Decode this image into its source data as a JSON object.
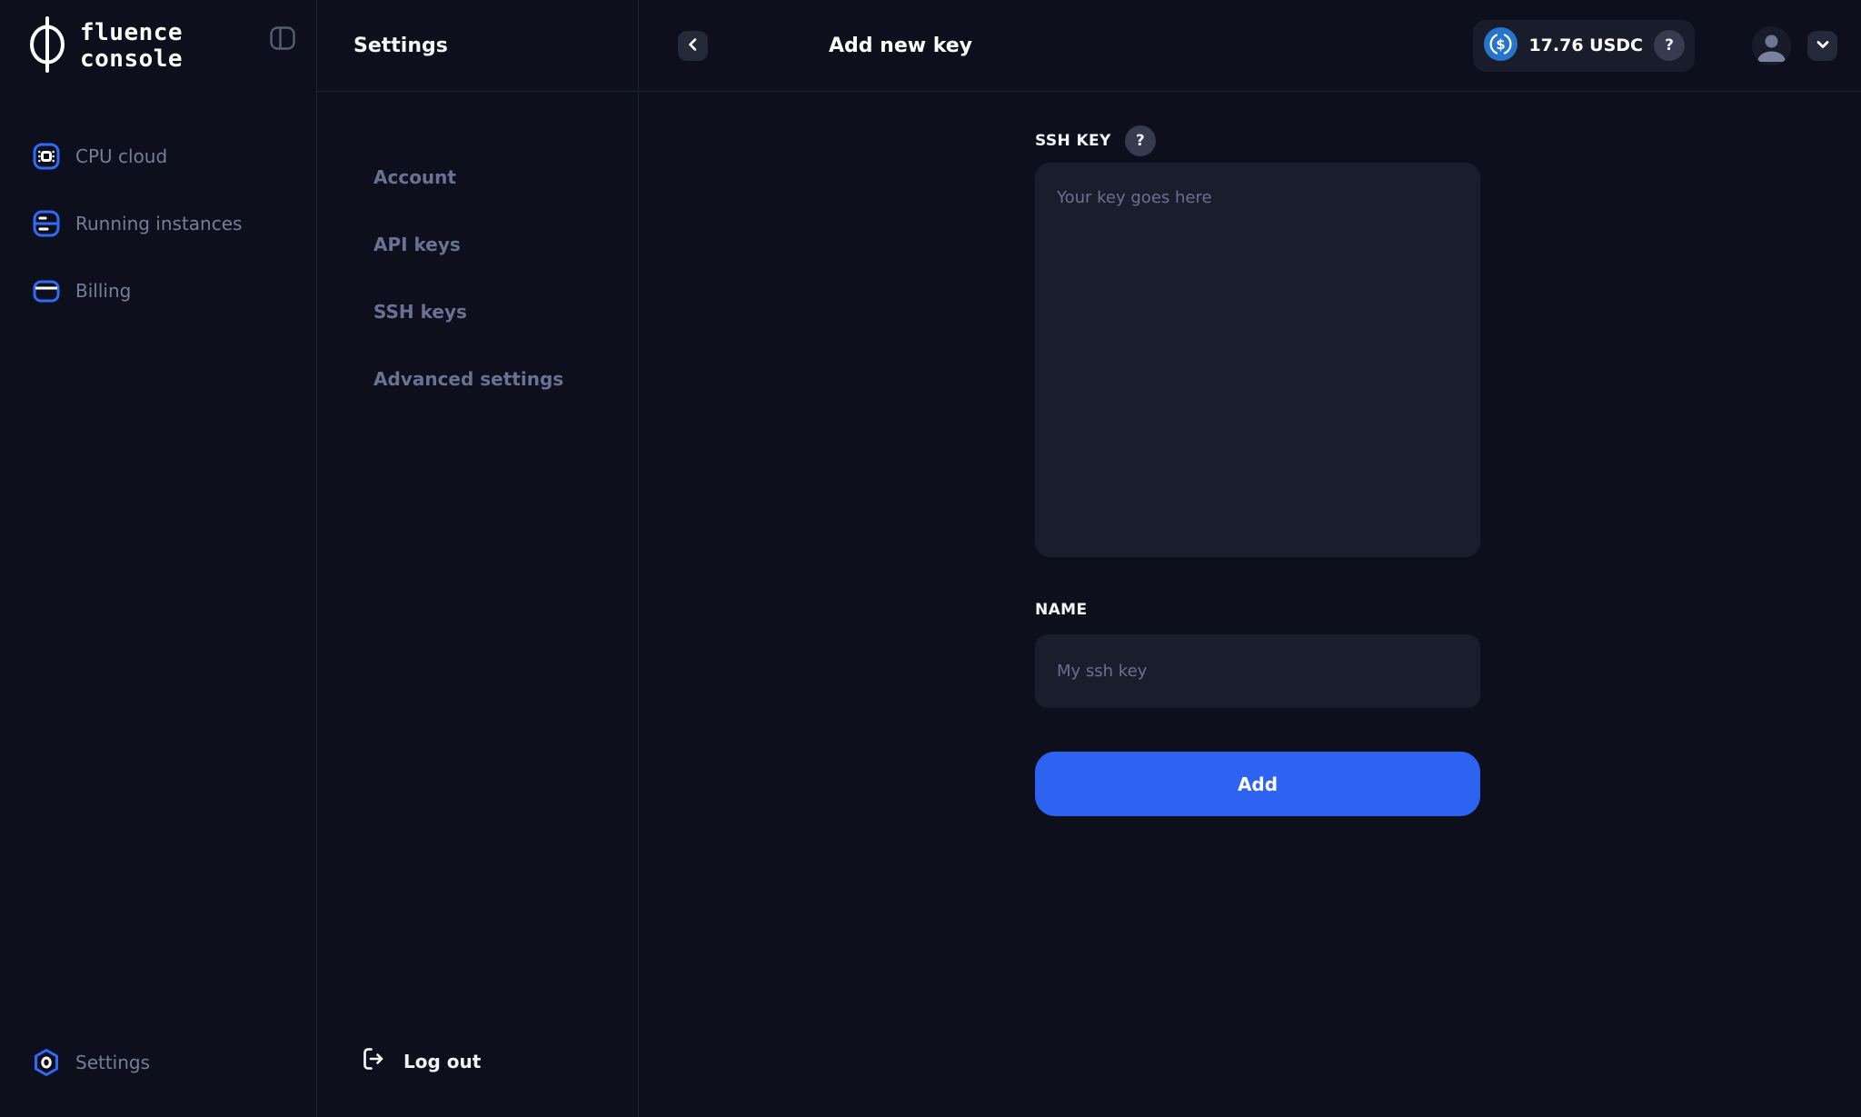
{
  "app": {
    "logo_line1": "fluence",
    "logo_line2": "console"
  },
  "sidebar": {
    "items": [
      {
        "label": "CPU cloud",
        "icon": "cpu-icon"
      },
      {
        "label": "Running instances",
        "icon": "server-icon"
      },
      {
        "label": "Billing",
        "icon": "credit-card-icon"
      }
    ],
    "bottom_item": {
      "label": "Settings",
      "icon": "hexagon-settings-icon"
    }
  },
  "settings_panel": {
    "title": "Settings",
    "nav": [
      {
        "label": "Account"
      },
      {
        "label": "API keys"
      },
      {
        "label": "SSH keys"
      },
      {
        "label": "Advanced settings"
      }
    ],
    "logout_label": "Log out"
  },
  "header": {
    "title": "Add new key",
    "balance": {
      "amount": "17.76 USDC",
      "currency_icon": "usdc-coin-icon",
      "help_label": "?"
    }
  },
  "form": {
    "ssh_key_label": "SSH KEY",
    "ssh_key_help": "?",
    "ssh_key_placeholder": "Your key goes here",
    "name_label": "NAME",
    "name_placeholder": "My ssh key",
    "submit_label": "Add"
  },
  "colors": {
    "background": "#0d101c",
    "panel_border": "#1e2333",
    "field_background": "#191d2c",
    "muted_text": "#6b7192",
    "accent_blue": "#2e63f2",
    "usdc_blue": "#2775ca"
  }
}
